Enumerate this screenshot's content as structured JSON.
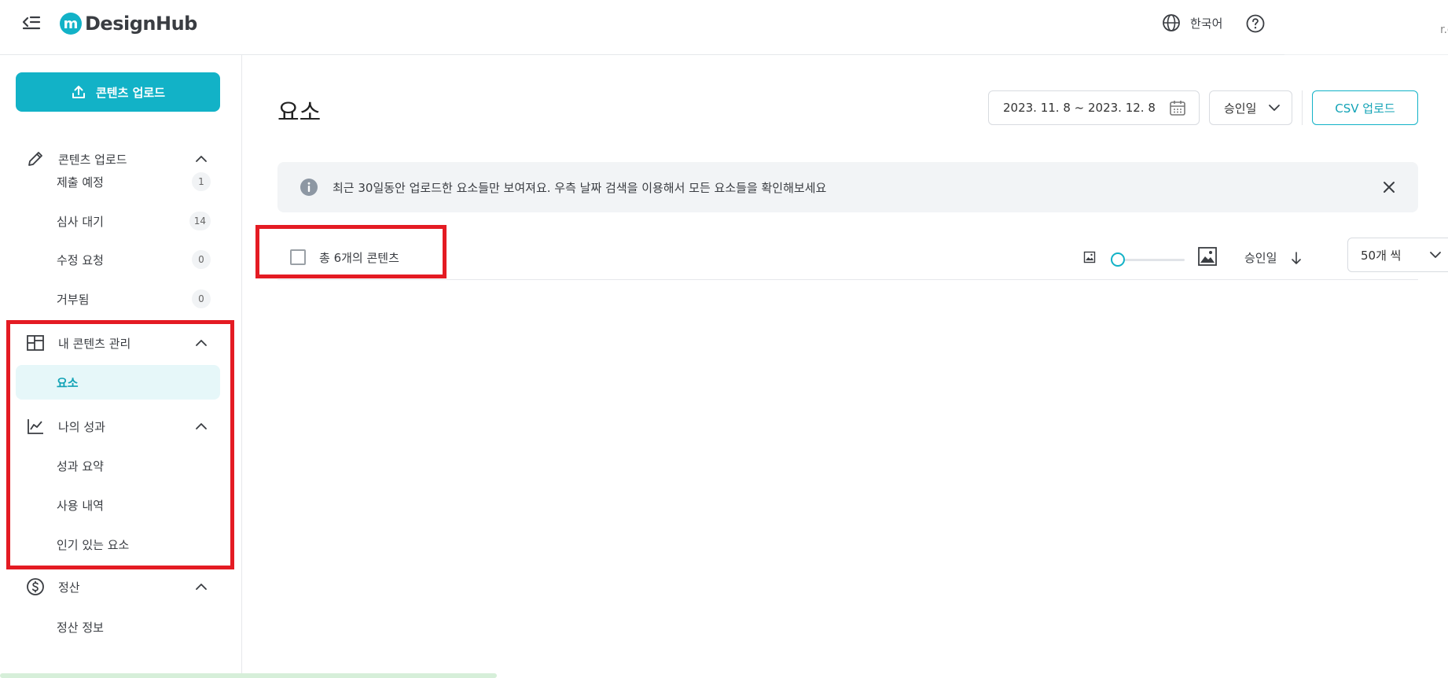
{
  "header": {
    "logo_mark": "m",
    "logo_text": "DesignHub",
    "language": "한국어",
    "edge_text": "r.c"
  },
  "sidebar": {
    "upload_button": "콘텐츠 업로드",
    "groups": [
      {
        "label": "콘텐츠 업로드",
        "icon": "pencil-icon",
        "items": [
          {
            "label": "제출 예정",
            "count": "1"
          },
          {
            "label": "심사 대기",
            "count": "14"
          },
          {
            "label": "수정 요청",
            "count": "0"
          },
          {
            "label": "거부됨",
            "count": "0"
          }
        ]
      },
      {
        "label": "내 콘텐츠 관리",
        "icon": "layout-grid-icon",
        "items": [
          {
            "label": "요소",
            "active": true
          }
        ]
      },
      {
        "label": "나의 성과",
        "icon": "line-chart-icon",
        "items": [
          {
            "label": "성과 요약"
          },
          {
            "label": "사용 내역"
          },
          {
            "label": "인기 있는 요소"
          }
        ]
      },
      {
        "label": "정산",
        "icon": "dollar-circle-icon",
        "items": [
          {
            "label": "정산 정보"
          }
        ]
      }
    ]
  },
  "main": {
    "title": "요소",
    "date_range": "2023. 11. 8 ~ 2023. 12. 8",
    "sort_by": "승인일",
    "csv_button": "CSV 업로드",
    "notice": "최근 30일동안 업로드한 요소들만 보여져요. 우측 날짜 검색을 이용해서 모든 요소들을 확인해보세요",
    "total_label": "총 6개의 콘텐츠",
    "thumbnail_size": 0,
    "sort_label": "승인일",
    "per_page": "50개 씩"
  },
  "colors": {
    "accent": "#12b2c7",
    "highlight": "#e41b23"
  }
}
